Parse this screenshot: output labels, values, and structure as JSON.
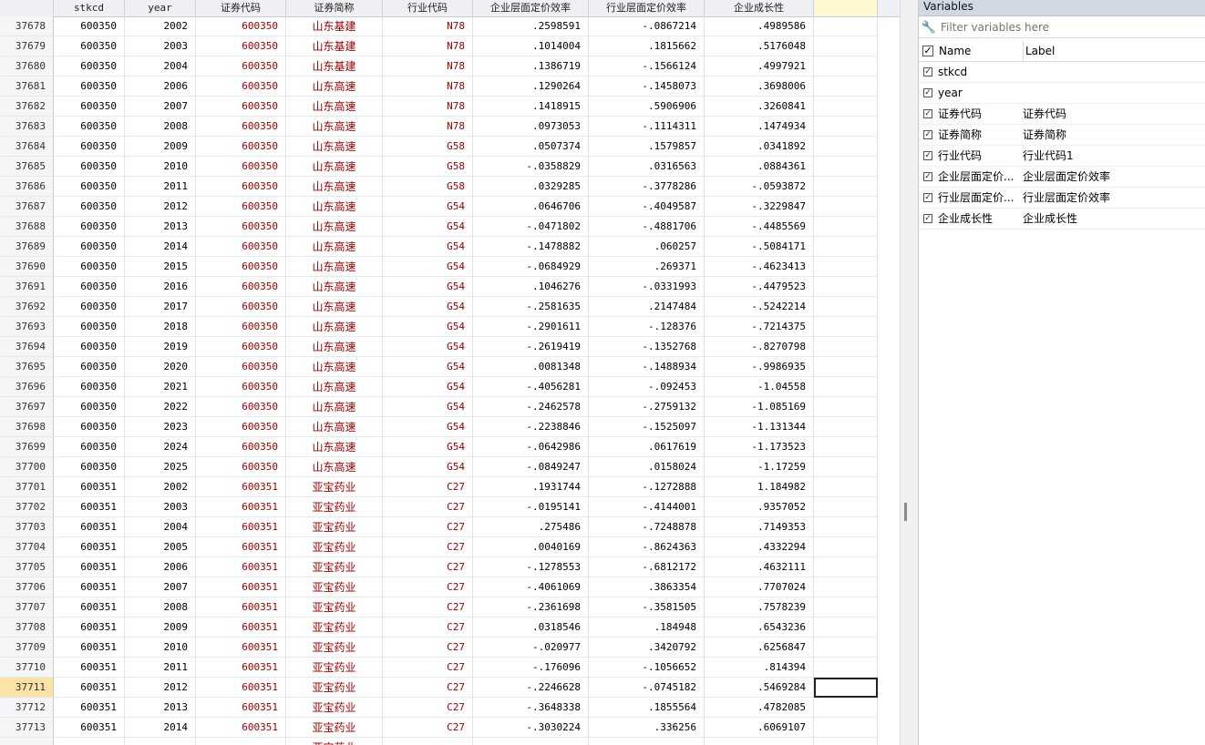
{
  "grid": {
    "headers": [
      "",
      "stkcd",
      "year",
      "证券代码",
      "证券简称",
      "行业代码",
      "企业层面定价效率",
      "行业层面定价效率",
      "企业成长性",
      ""
    ],
    "rows": [
      [
        "37678",
        "600350",
        "2002",
        "600350",
        "山东基建",
        "N78",
        ".2598591",
        "-.0867214",
        ".4989586"
      ],
      [
        "37679",
        "600350",
        "2003",
        "600350",
        "山东基建",
        "N78",
        ".1014004",
        ".1815662",
        ".5176048"
      ],
      [
        "37680",
        "600350",
        "2004",
        "600350",
        "山东基建",
        "N78",
        ".1386719",
        "-.1566124",
        ".4997921"
      ],
      [
        "37681",
        "600350",
        "2006",
        "600350",
        "山东高速",
        "N78",
        ".1290264",
        "-.1458073",
        ".3698006"
      ],
      [
        "37682",
        "600350",
        "2007",
        "600350",
        "山东高速",
        "N78",
        ".1418915",
        ".5906906",
        ".3260841"
      ],
      [
        "37683",
        "600350",
        "2008",
        "600350",
        "山东高速",
        "N78",
        ".0973053",
        "-.1114311",
        ".1474934"
      ],
      [
        "37684",
        "600350",
        "2009",
        "600350",
        "山东高速",
        "G58",
        ".0507374",
        ".1579857",
        ".0341892"
      ],
      [
        "37685",
        "600350",
        "2010",
        "600350",
        "山东高速",
        "G58",
        "-.0358829",
        ".0316563",
        ".0884361"
      ],
      [
        "37686",
        "600350",
        "2011",
        "600350",
        "山东高速",
        "G58",
        ".0329285",
        "-.3778286",
        "-.0593872"
      ],
      [
        "37687",
        "600350",
        "2012",
        "600350",
        "山东高速",
        "G54",
        ".0646706",
        "-.4049587",
        "-.3229847"
      ],
      [
        "37688",
        "600350",
        "2013",
        "600350",
        "山东高速",
        "G54",
        "-.0471802",
        "-.4881706",
        "-.4485569"
      ],
      [
        "37689",
        "600350",
        "2014",
        "600350",
        "山东高速",
        "G54",
        "-.1478882",
        ".060257",
        "-.5084171"
      ],
      [
        "37690",
        "600350",
        "2015",
        "600350",
        "山东高速",
        "G54",
        "-.0684929",
        ".269371",
        "-.4623413"
      ],
      [
        "37691",
        "600350",
        "2016",
        "600350",
        "山东高速",
        "G54",
        ".1046276",
        "-.0331993",
        "-.4479523"
      ],
      [
        "37692",
        "600350",
        "2017",
        "600350",
        "山东高速",
        "G54",
        "-.2581635",
        ".2147484",
        "-.5242214"
      ],
      [
        "37693",
        "600350",
        "2018",
        "600350",
        "山东高速",
        "G54",
        "-.2901611",
        "-.128376",
        "-.7214375"
      ],
      [
        "37694",
        "600350",
        "2019",
        "600350",
        "山东高速",
        "G54",
        "-.2619419",
        "-.1352768",
        "-.8270798"
      ],
      [
        "37695",
        "600350",
        "2020",
        "600350",
        "山东高速",
        "G54",
        ".0081348",
        "-.1488934",
        "-.9986935"
      ],
      [
        "37696",
        "600350",
        "2021",
        "600350",
        "山东高速",
        "G54",
        "-.4056281",
        "-.092453",
        "-1.04558"
      ],
      [
        "37697",
        "600350",
        "2022",
        "600350",
        "山东高速",
        "G54",
        "-.2462578",
        "-.2759132",
        "-1.085169"
      ],
      [
        "37698",
        "600350",
        "2023",
        "600350",
        "山东高速",
        "G54",
        "-.2238846",
        "-.1525097",
        "-1.131344"
      ],
      [
        "37699",
        "600350",
        "2024",
        "600350",
        "山东高速",
        "G54",
        "-.0642986",
        ".0617619",
        "-1.173523"
      ],
      [
        "37700",
        "600350",
        "2025",
        "600350",
        "山东高速",
        "G54",
        "-.0849247",
        ".0158024",
        "-1.17259"
      ],
      [
        "37701",
        "600351",
        "2002",
        "600351",
        "亚宝药业",
        "C27",
        ".1931744",
        "-.1272888",
        "1.184982"
      ],
      [
        "37702",
        "600351",
        "2003",
        "600351",
        "亚宝药业",
        "C27",
        "-.0195141",
        "-.4144001",
        ".9357052"
      ],
      [
        "37703",
        "600351",
        "2004",
        "600351",
        "亚宝药业",
        "C27",
        ".275486",
        "-.7248878",
        ".7149353"
      ],
      [
        "37704",
        "600351",
        "2005",
        "600351",
        "亚宝药业",
        "C27",
        ".0040169",
        "-.8624363",
        ".4332294"
      ],
      [
        "37705",
        "600351",
        "2006",
        "600351",
        "亚宝药业",
        "C27",
        "-.1278553",
        "-.6812172",
        ".4632111"
      ],
      [
        "37706",
        "600351",
        "2007",
        "600351",
        "亚宝药业",
        "C27",
        "-.4061069",
        ".3863354",
        ".7707024"
      ],
      [
        "37707",
        "600351",
        "2008",
        "600351",
        "亚宝药业",
        "C27",
        "-.2361698",
        "-.3581505",
        ".7578239"
      ],
      [
        "37708",
        "600351",
        "2009",
        "600351",
        "亚宝药业",
        "C27",
        ".0318546",
        ".184948",
        ".6543236"
      ],
      [
        "37709",
        "600351",
        "2010",
        "600351",
        "亚宝药业",
        "C27",
        "-.020977",
        ".3420792",
        ".6256847"
      ],
      [
        "37710",
        "600351",
        "2011",
        "600351",
        "亚宝药业",
        "C27",
        "-.176096",
        "-.1056652",
        ".814394"
      ],
      [
        "37711",
        "600351",
        "2012",
        "600351",
        "亚宝药业",
        "C27",
        "-.2246628",
        "-.0745182",
        ".5469284"
      ],
      [
        "37712",
        "600351",
        "2013",
        "600351",
        "亚宝药业",
        "C27",
        "-.3648338",
        ".1855564",
        ".4782085"
      ],
      [
        "37713",
        "600351",
        "2014",
        "600351",
        "亚宝药业",
        "C27",
        "-.3030224",
        ".336256",
        ".6069107"
      ],
      [
        "",
        "",
        "",
        "",
        "亚宝药业",
        "",
        "",
        "",
        ""
      ]
    ],
    "selected_row": "37711"
  },
  "vars_panel": {
    "title": "Variables",
    "filter_placeholder": "Filter variables here",
    "col_name": "Name",
    "col_label": "Label",
    "items": [
      {
        "name": "stkcd",
        "label": "",
        "checked": true
      },
      {
        "name": "year",
        "label": "",
        "checked": true
      },
      {
        "name": "证券代码",
        "label": "证券代码",
        "checked": true
      },
      {
        "name": "证券简称",
        "label": "证券简称",
        "checked": true
      },
      {
        "name": "行业代码",
        "label": "行业代码1",
        "checked": true
      },
      {
        "name": "企业层面定价...",
        "label": "企业层面定价效率",
        "checked": true
      },
      {
        "name": "行业层面定价...",
        "label": "行业层面定价效率",
        "checked": true
      },
      {
        "name": "企业成长性",
        "label": "企业成长性",
        "checked": true
      }
    ]
  },
  "colors": {
    "string_var": "#a00000",
    "selected_rownum": "#fbe3a8",
    "panel_title_bg": "#cfd8e3"
  }
}
